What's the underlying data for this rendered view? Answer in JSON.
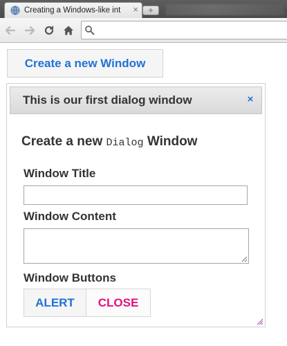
{
  "browser": {
    "tab_title": "Creating a Windows-like int",
    "tab_close": "×",
    "new_tab": "+",
    "icons": {
      "favicon": "globe-icon",
      "back": "arrow-left-icon",
      "forward": "arrow-right-icon",
      "reload": "reload-icon",
      "home": "home-icon",
      "search": "search-icon"
    },
    "omnibox_value": ""
  },
  "page": {
    "create_window_button": "Create a new Window",
    "accent_color": "#1e72d8",
    "close_color": "#e3127d"
  },
  "dialog": {
    "title": "This is our first dialog window",
    "close_glyph": "×",
    "form_heading": {
      "prefix": "Create a new",
      "code": "Dialog",
      "suffix": "Window"
    },
    "fields": {
      "title_label": "Window Title",
      "title_value": "",
      "content_label": "Window Content",
      "content_value": "",
      "buttons_label": "Window Buttons"
    },
    "buttons": {
      "alert": "ALERT",
      "close": "CLOSE"
    }
  }
}
